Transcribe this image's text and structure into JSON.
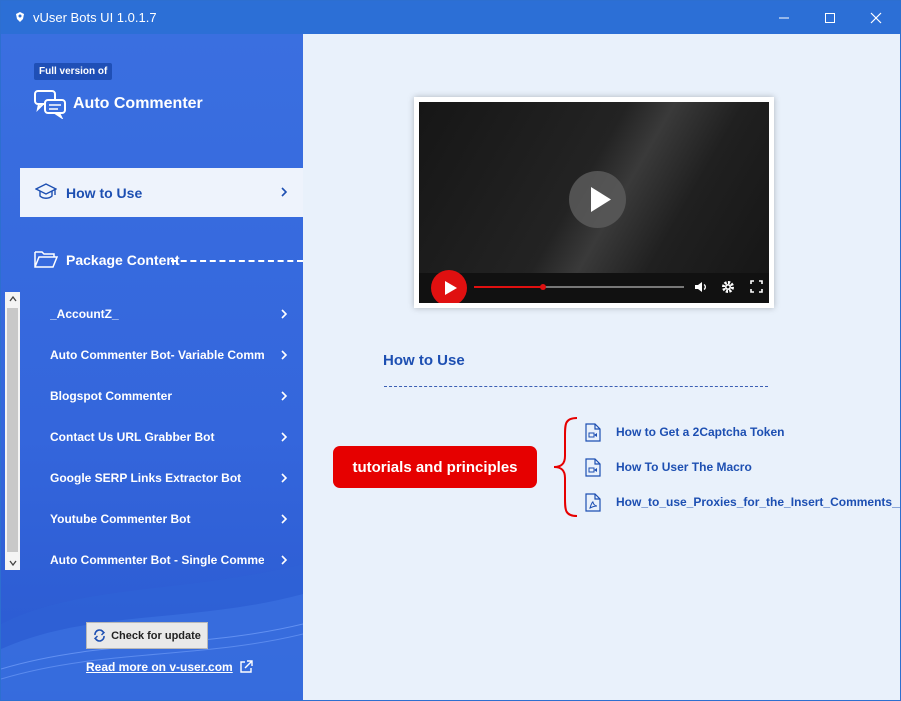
{
  "window": {
    "title": "vUser Bots UI 1.0.1.7",
    "accent_color": "#2c6fd6"
  },
  "sidebar": {
    "badge": "Full version of",
    "product_title": "Auto Commenter",
    "nav_how_to_use": "How to Use",
    "package_content": "Package Content",
    "items": [
      {
        "label": "_AccountZ_"
      },
      {
        "label": "Auto Commenter Bot- Variable Comment Version"
      },
      {
        "label": "Blogspot Commenter"
      },
      {
        "label": "Contact Us URL Grabber Bot"
      },
      {
        "label": "Google SERP Links Extractor Bot"
      },
      {
        "label": "Youtube Commenter Bot"
      },
      {
        "label": "Auto Commenter Bot - Single Comment"
      }
    ],
    "update_button": "Check for update",
    "read_more": "Read more on v-user.com"
  },
  "main": {
    "video": {
      "progress_percent": 33,
      "icons": [
        "play-icon",
        "volume-icon",
        "settings-icon",
        "fullscreen-icon"
      ]
    },
    "section_title": "How to Use",
    "callout": "tutorials and principles",
    "callout_color": "#e60000",
    "links": [
      {
        "label": "How to Get a 2Captcha Token",
        "icon": "video-file-icon"
      },
      {
        "label": "How To User The Macro",
        "icon": "video-file-icon"
      },
      {
        "label": "How_to_use_Proxies_for_the_Insert_Comments__Backlinks",
        "icon": "pdf-file-icon"
      }
    ]
  }
}
